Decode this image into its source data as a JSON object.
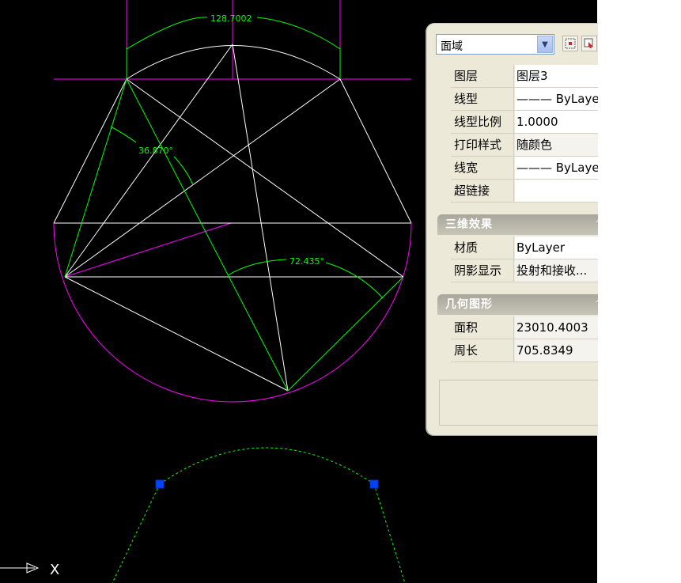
{
  "drawing": {
    "dims": {
      "top": "128.7002",
      "left_angle": "36.870°",
      "bottom_angle": "72.435°"
    },
    "axis_x": "X"
  },
  "properties": {
    "object_type": "面域",
    "basic": [
      {
        "label": "图层",
        "value": "图层3"
      },
      {
        "label": "线型",
        "value": "——— ByLayer"
      },
      {
        "label": "线型比例",
        "value": "1.0000"
      },
      {
        "label": "打印样式",
        "value": "随颜色"
      },
      {
        "label": "线宽",
        "value": "——— ByLayer"
      },
      {
        "label": "超链接",
        "value": ""
      }
    ],
    "section_3d": "三维效果",
    "effects": [
      {
        "label": "材质",
        "value": "ByLayer"
      },
      {
        "label": "阴影显示",
        "value": "投射和接收..."
      }
    ],
    "section_geom": "几何图形",
    "geometry": [
      {
        "label": "面积",
        "value": "23010.4003"
      },
      {
        "label": "周长",
        "value": "705.8349"
      }
    ]
  },
  "colors": {
    "canvas": "#000000",
    "line_white": "#ffffff",
    "line_green": "#00ff00",
    "line_magenta": "#ff00ff",
    "grip_blue": "#0044ff"
  },
  "icons": [
    "dropdown-arrow-icon",
    "quick-select-icon",
    "select-objects-icon",
    "collapse-chevron-icon"
  ]
}
